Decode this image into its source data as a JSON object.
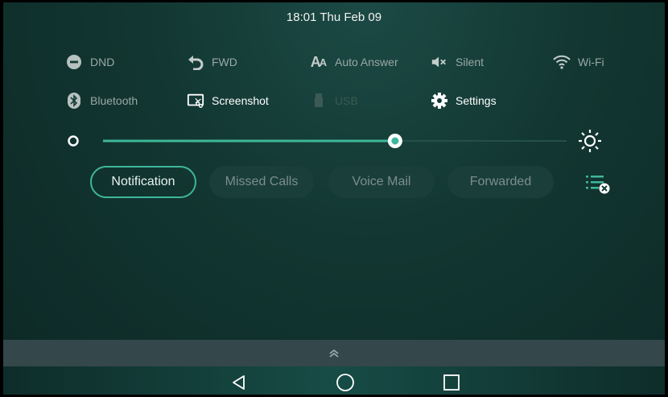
{
  "status_bar": {
    "datetime": "18:01 Thu Feb 09"
  },
  "quick_settings": {
    "row1": [
      {
        "label": "DND",
        "icon": "dnd-icon",
        "state": "off"
      },
      {
        "label": "FWD",
        "icon": "forward-icon",
        "state": "off"
      },
      {
        "label": "Auto Answer",
        "icon": "auto-answer-icon",
        "state": "off"
      },
      {
        "label": "Silent",
        "icon": "silent-icon",
        "state": "off"
      },
      {
        "label": "Wi-Fi",
        "icon": "wifi-icon",
        "state": "off"
      }
    ],
    "row2": [
      {
        "label": "Bluetooth",
        "icon": "bluetooth-icon",
        "state": "off"
      },
      {
        "label": "Screenshot",
        "icon": "screenshot-icon",
        "state": "on"
      },
      {
        "label": "USB",
        "icon": "usb-icon",
        "state": "disabled"
      },
      {
        "label": "Settings",
        "icon": "gear-icon",
        "state": "on"
      }
    ]
  },
  "brightness": {
    "level": 0.63
  },
  "tabs": [
    {
      "label": "Notification",
      "active": true
    },
    {
      "label": "Missed Calls",
      "active": false
    },
    {
      "label": "Voice Mail",
      "active": false
    },
    {
      "label": "Forwarded",
      "active": false
    }
  ],
  "colors": {
    "accent": "#3fb79a",
    "background": "#123631",
    "nav_bar": "#174c46"
  }
}
